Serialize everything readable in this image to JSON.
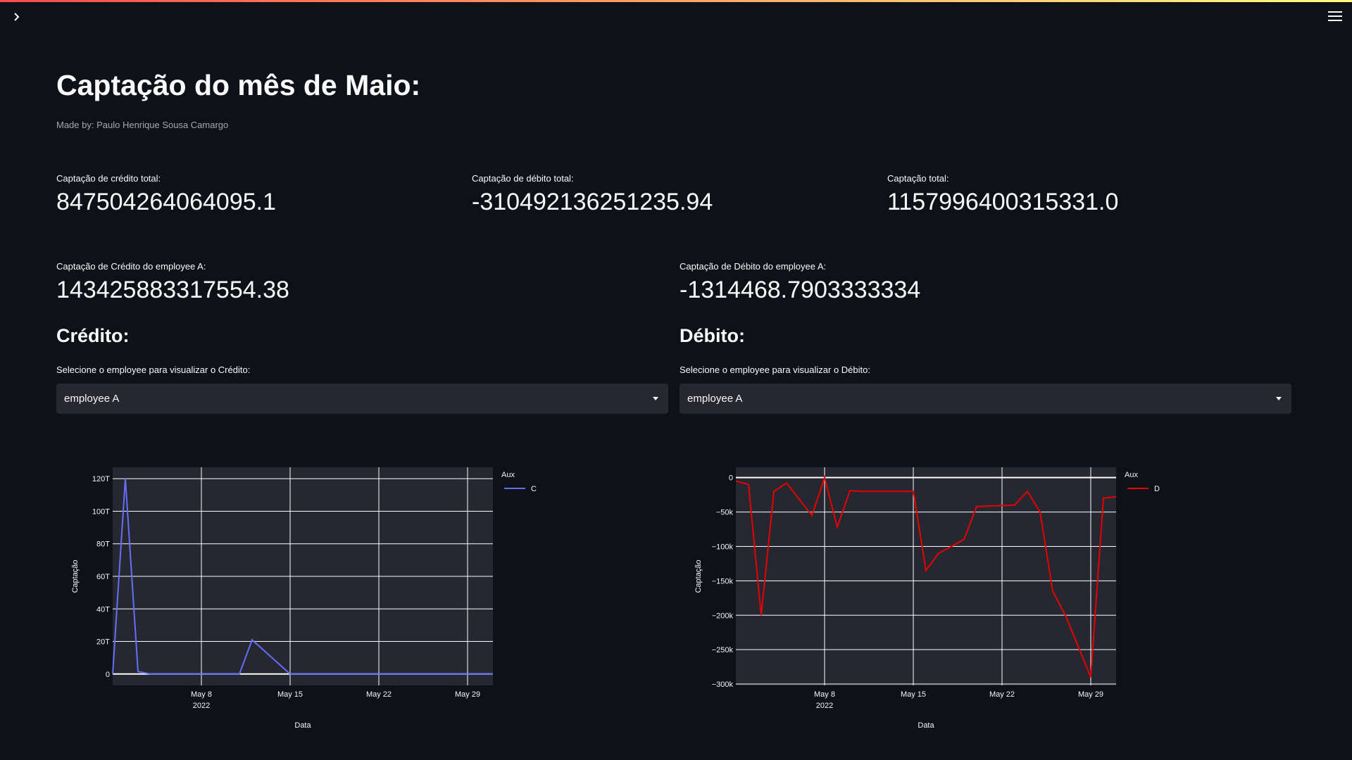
{
  "page": {
    "title": "Captação do mês de Maio:",
    "subtitle": "Made by: Paulo Henrique Sousa Camargo"
  },
  "metrics_top": [
    {
      "label": "Captação de crédito total:",
      "value": "847504264064095.1"
    },
    {
      "label": "Captação de débito total:",
      "value": "-310492136251235.94"
    },
    {
      "label": "Captação total:",
      "value": "1157996400315331.0"
    }
  ],
  "metrics_employee": [
    {
      "label": "Captação de Crédito do employee A:",
      "value": "143425883317554.38"
    },
    {
      "label": "Captação de Débito do employee A:",
      "value": "-1314468.7903333334"
    }
  ],
  "credit_section": {
    "heading": "Crédito:",
    "select_label": "Selecione o employee para visualizar o Crédito:",
    "selected": "employee A"
  },
  "debit_section": {
    "heading": "Débito:",
    "select_label": "Selecione o employee para visualizar o Débito:",
    "selected": "employee A"
  },
  "chart_data": [
    {
      "type": "line",
      "xlabel": "Data",
      "ylabel": "Captação",
      "legend_title": "Aux",
      "legend_position": "right",
      "grid": true,
      "x_ticks": [
        "May 8",
        "May 15",
        "May 22",
        "May 29"
      ],
      "x_year": "2022",
      "y_ticks": [
        "0",
        "20T",
        "40T",
        "60T",
        "80T",
        "100T",
        "120T"
      ],
      "ylim": [
        -7,
        127
      ],
      "xlim": [
        1,
        31
      ],
      "series": [
        {
          "name": "C",
          "color": "#636efa",
          "x": [
            1,
            2,
            3,
            4,
            11,
            12,
            13,
            14,
            15,
            16,
            17,
            18,
            19,
            20,
            21,
            22,
            23,
            24,
            25,
            26,
            27,
            28,
            29,
            30,
            31
          ],
          "y": [
            0,
            120,
            1.5,
            0,
            0,
            21,
            14,
            7,
            0,
            0,
            0,
            0,
            0,
            0,
            0,
            0,
            0,
            0,
            0,
            0,
            0,
            0,
            0,
            0,
            0
          ]
        }
      ]
    },
    {
      "type": "line",
      "xlabel": "Data",
      "ylabel": "Captação",
      "legend_title": "Aux",
      "legend_position": "right",
      "grid": true,
      "x_ticks": [
        "May 8",
        "May 15",
        "May 22",
        "May 29"
      ],
      "x_year": "2022",
      "y_ticks": [
        "0",
        "−50k",
        "−100k",
        "−150k",
        "−200k",
        "−250k",
        "−300k"
      ],
      "ylim": [
        -302,
        15
      ],
      "xlim": [
        1,
        31
      ],
      "series": [
        {
          "name": "D",
          "color": "#e60000",
          "x": [
            1,
            2,
            3,
            4,
            5,
            7,
            8,
            9,
            10,
            11,
            12,
            13,
            14,
            15,
            16,
            17,
            18,
            19,
            20,
            23,
            24,
            25,
            26,
            27,
            29,
            30,
            31
          ],
          "y": [
            -5,
            -10,
            -200,
            -20,
            -8,
            -55,
            0,
            -72,
            -19,
            -20,
            -20,
            -20,
            -20,
            -20,
            -135,
            -110,
            -100,
            -90,
            -42,
            -40,
            -20,
            -50,
            -165,
            -200,
            -290,
            -30,
            -28
          ]
        }
      ]
    }
  ]
}
